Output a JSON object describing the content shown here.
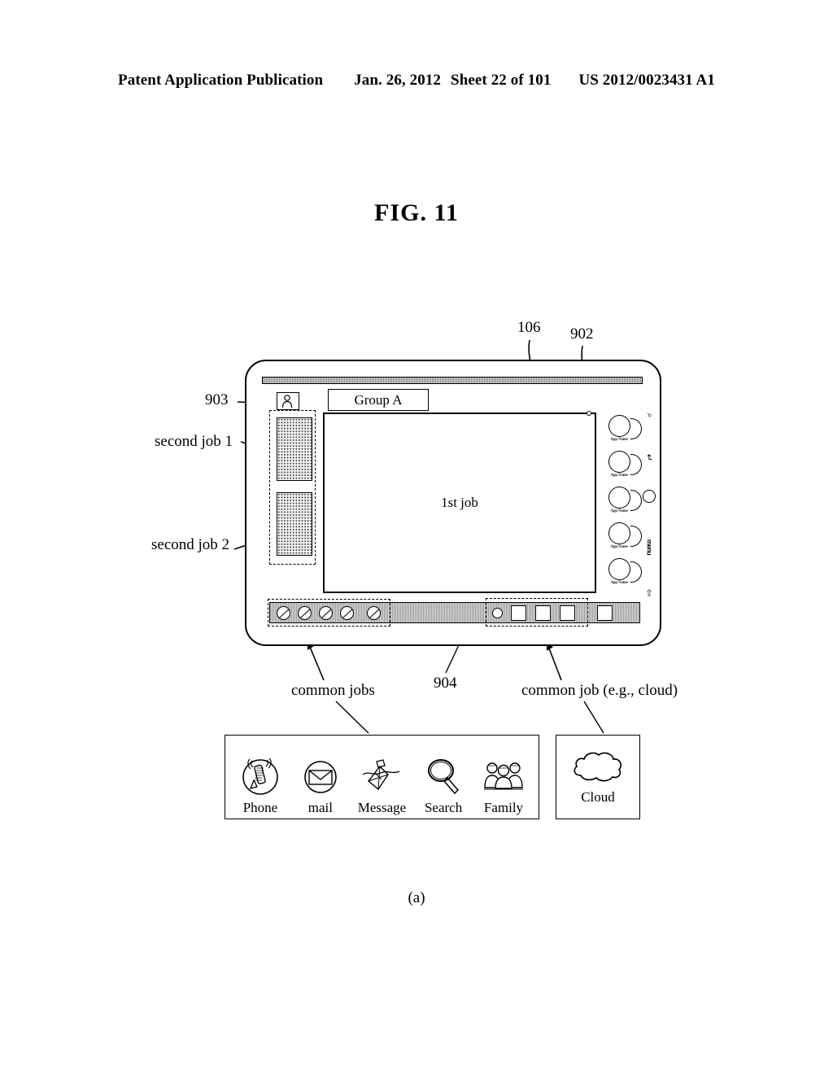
{
  "header": {
    "publication": "Patent Application Publication",
    "date": "Jan. 26, 2012",
    "sheet": "Sheet 22 of 101",
    "number": "US 2012/0023431 A1"
  },
  "figure": {
    "title": "FIG. 11",
    "sub_caption": "(a)"
  },
  "callouts": {
    "ref_106": "106",
    "ref_902": "902",
    "ref_903": "903",
    "ref_904": "904",
    "second_job_1": "second job 1",
    "second_job_2": "second job 2",
    "common_jobs": "common jobs",
    "common_job_cloud": "common job (e.g., cloud)"
  },
  "device": {
    "group_tab_label": "Group A",
    "avatar_icon": "person-icon",
    "main_window_label": "1st job",
    "second_jobs": [
      {
        "id": "second-job-1"
      },
      {
        "id": "second-job-2"
      }
    ],
    "app_rail": [
      {
        "label": "App Name"
      },
      {
        "label": "App Name"
      },
      {
        "label": "App Name"
      },
      {
        "label": "App Name"
      },
      {
        "label": "App Name"
      }
    ],
    "edge_controls": [
      {
        "icon": "search-icon",
        "glyph": "⌕"
      },
      {
        "icon": "back-arrow-icon",
        "glyph": "↵"
      },
      {
        "icon": "home-button-icon",
        "glyph": ""
      },
      {
        "icon": "menu-icon",
        "glyph": "menu"
      },
      {
        "icon": "back-icon",
        "glyph": "⇦"
      }
    ],
    "dock": {
      "common_job_circles": 5,
      "cloud_group_circles": 1,
      "cloud_group_squares": 3,
      "trailing_squares": 1
    }
  },
  "legend_common": {
    "items": [
      {
        "icon": "phone-icon",
        "label": "Phone"
      },
      {
        "icon": "mail-icon",
        "label": "mail"
      },
      {
        "icon": "message-icon",
        "label": "Message"
      },
      {
        "icon": "search-icon",
        "label": "Search"
      },
      {
        "icon": "family-icon",
        "label": "Family"
      }
    ]
  },
  "legend_cloud": {
    "icon": "cloud-icon",
    "label": "Cloud"
  }
}
